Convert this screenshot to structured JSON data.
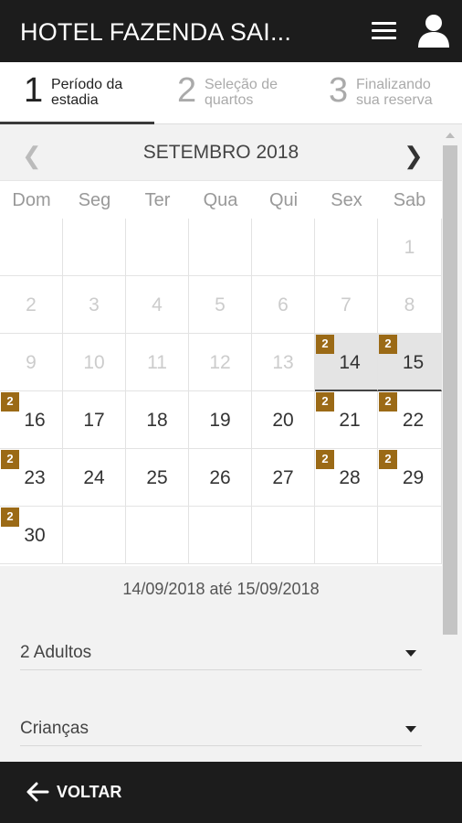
{
  "header": {
    "title": "HOTEL FAZENDA SAI...",
    "menu_icon": "hamburger-menu-icon",
    "user_icon": "user-avatar-icon"
  },
  "steps": [
    {
      "number": "1",
      "label_line1": "Período da",
      "label_line2": "estadia",
      "active": true
    },
    {
      "number": "2",
      "label_line1": "Seleção de",
      "label_line2": "quartos",
      "active": false
    },
    {
      "number": "3",
      "label_line1": "Finalizando",
      "label_line2": "sua reserva",
      "active": false
    }
  ],
  "calendar": {
    "month_label": "SETEMBRO 2018",
    "prev_icon": "chevron-left-icon",
    "next_icon": "chevron-right-icon",
    "weekdays": [
      "Dom",
      "Seg",
      "Ter",
      "Qua",
      "Qui",
      "Sex",
      "Sab"
    ],
    "days": [
      {
        "day": "",
        "disabled": true
      },
      {
        "day": "",
        "disabled": true
      },
      {
        "day": "",
        "disabled": true
      },
      {
        "day": "",
        "disabled": true
      },
      {
        "day": "",
        "disabled": true
      },
      {
        "day": "",
        "disabled": true
      },
      {
        "day": "1",
        "disabled": true
      },
      {
        "day": "2",
        "disabled": true
      },
      {
        "day": "3",
        "disabled": true
      },
      {
        "day": "4",
        "disabled": true
      },
      {
        "day": "5",
        "disabled": true
      },
      {
        "day": "6",
        "disabled": true
      },
      {
        "day": "7",
        "disabled": true
      },
      {
        "day": "8",
        "disabled": true
      },
      {
        "day": "9",
        "disabled": true
      },
      {
        "day": "10",
        "disabled": true
      },
      {
        "day": "11",
        "disabled": true
      },
      {
        "day": "12",
        "disabled": true
      },
      {
        "day": "13",
        "disabled": true
      },
      {
        "day": "14",
        "badge": "2",
        "selected": true
      },
      {
        "day": "15",
        "badge": "2",
        "selected": true
      },
      {
        "day": "16",
        "badge": "2"
      },
      {
        "day": "17"
      },
      {
        "day": "18"
      },
      {
        "day": "19"
      },
      {
        "day": "20"
      },
      {
        "day": "21",
        "badge": "2"
      },
      {
        "day": "22",
        "badge": "2"
      },
      {
        "day": "23",
        "badge": "2"
      },
      {
        "day": "24"
      },
      {
        "day": "25"
      },
      {
        "day": "26"
      },
      {
        "day": "27"
      },
      {
        "day": "28",
        "badge": "2"
      },
      {
        "day": "29",
        "badge": "2"
      },
      {
        "day": "30",
        "badge": "2"
      },
      {
        "day": ""
      },
      {
        "day": ""
      },
      {
        "day": ""
      },
      {
        "day": ""
      },
      {
        "day": ""
      },
      {
        "day": ""
      }
    ],
    "range_text": "14/09/2018 até 15/09/2018"
  },
  "form": {
    "adults_value": "2 Adultos",
    "children_value": "Crianças"
  },
  "footer": {
    "back_label": "VOLTAR",
    "back_icon": "arrow-left-icon"
  },
  "colors": {
    "bar_background": "#1c1c1c",
    "badge": "#9b6a16",
    "selected_cell": "#e4e4e4"
  }
}
